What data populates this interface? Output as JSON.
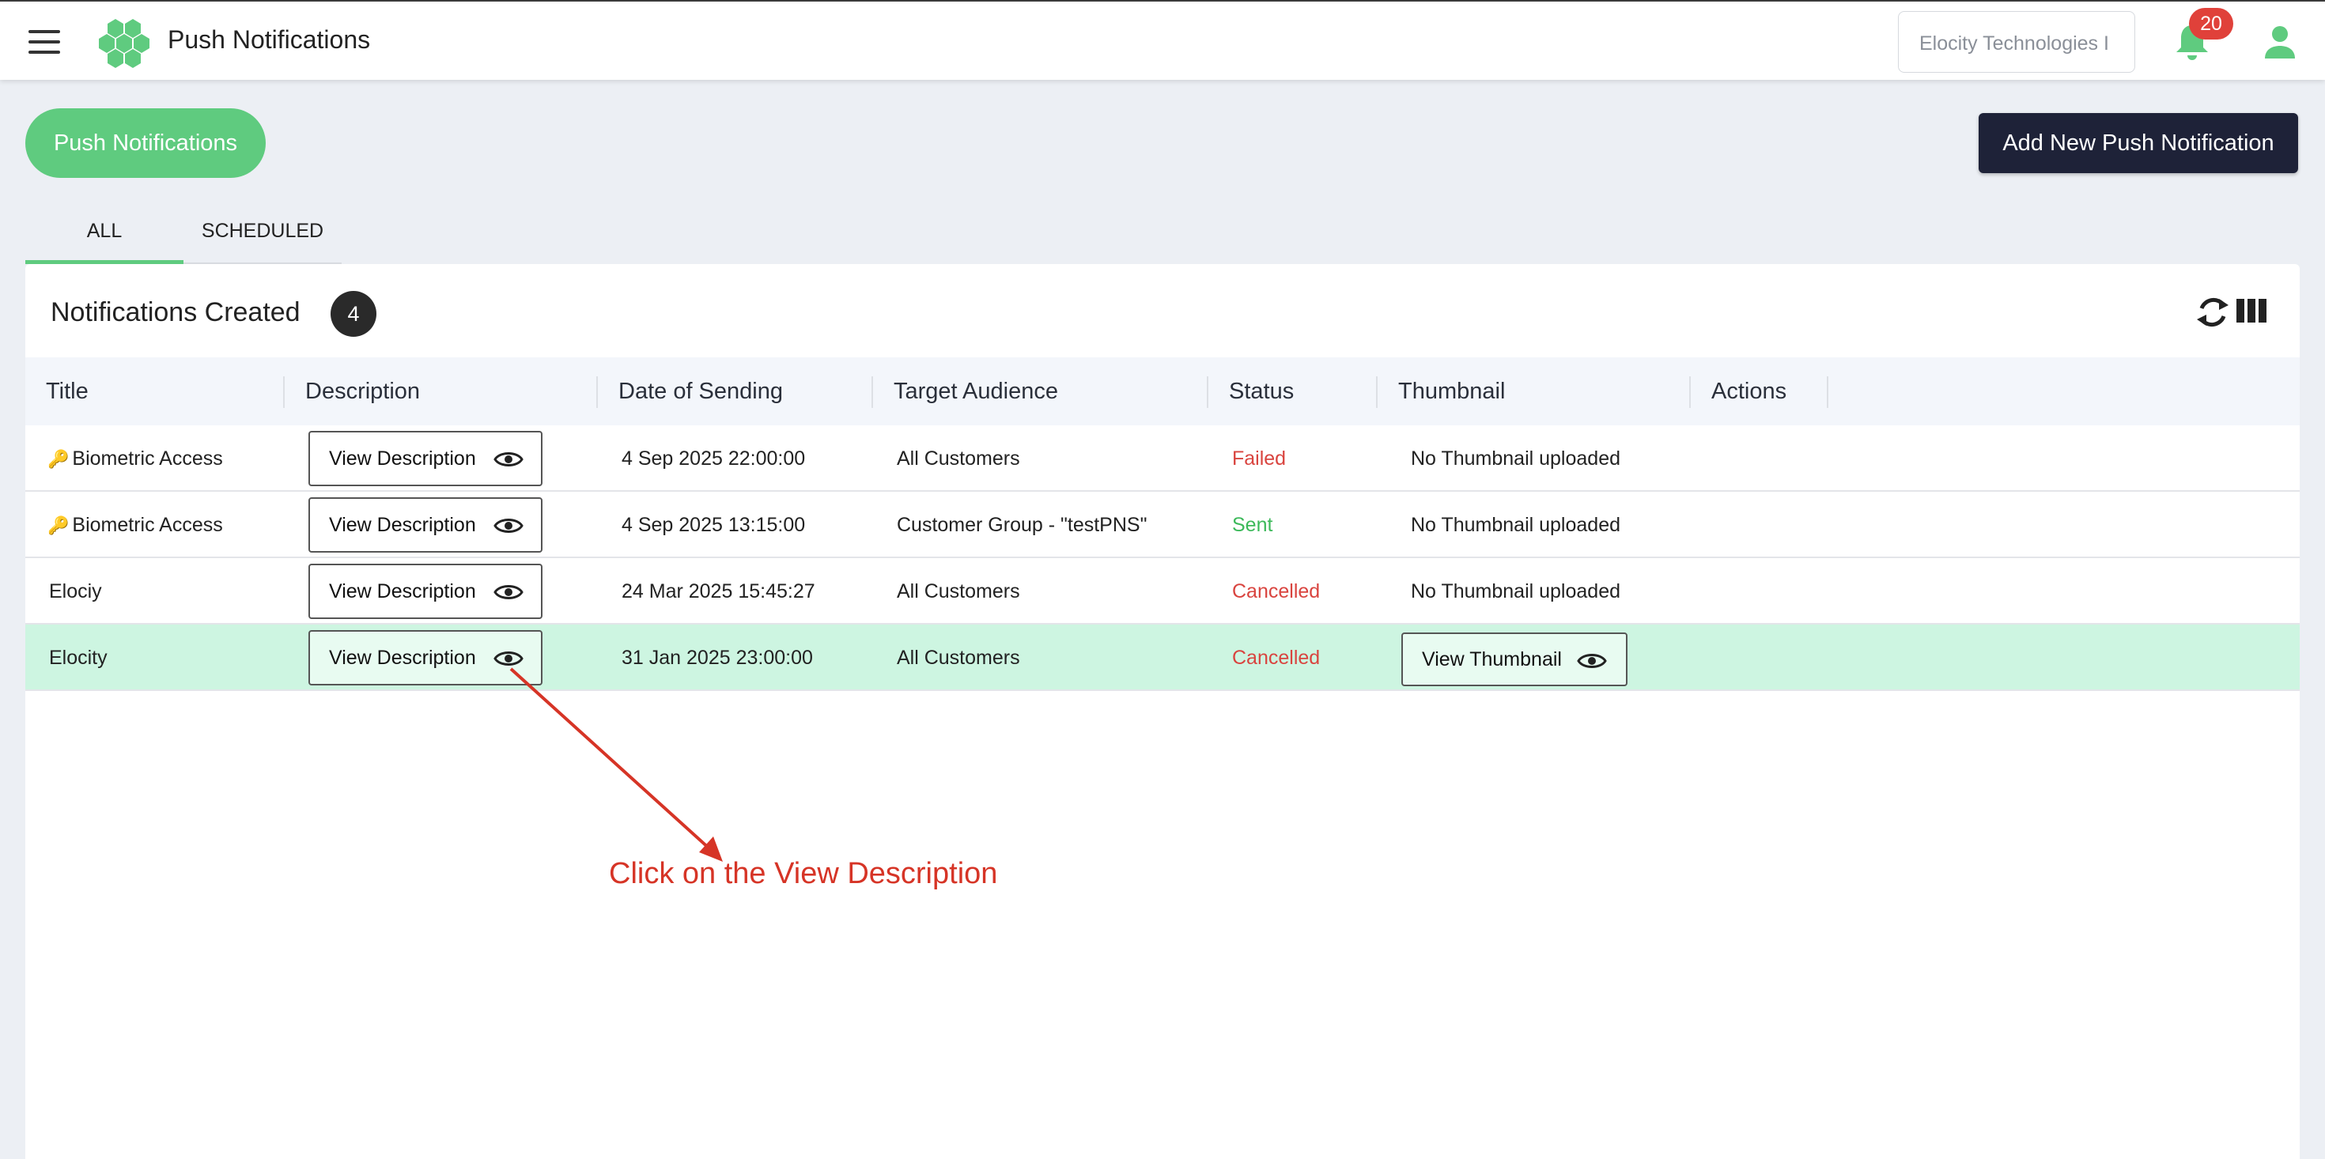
{
  "header": {
    "app_title": "Push Notifications",
    "org_selector_value": "Elocity Technologies I",
    "notification_count": "20",
    "accent_color": "#5fcb7f"
  },
  "toolbar": {
    "section_pill_label": "Push Notifications",
    "add_button_label": "Add New Push Notification"
  },
  "tabs": [
    {
      "label": "ALL",
      "active": true
    },
    {
      "label": "SCHEDULED",
      "active": false
    }
  ],
  "card": {
    "title": "Notifications Created",
    "count": "4"
  },
  "table": {
    "columns": [
      "Title",
      "Description",
      "Date of Sending",
      "Target Audience",
      "Status",
      "Thumbnail",
      "Actions"
    ],
    "rows": [
      {
        "title": "Biometric Access",
        "title_icon": "key-icon",
        "description_button": "View Description",
        "date": "4 Sep 2025 22:00:00",
        "audience": "All Customers",
        "status": "Failed",
        "thumbnail": "No Thumbnail uploaded"
      },
      {
        "title": "Biometric Access",
        "title_icon": "key-icon",
        "description_button": "View Description",
        "date": "4 Sep 2025 13:15:00",
        "audience": "Customer Group - \"testPNS\"",
        "status": "Sent",
        "thumbnail": "No Thumbnail uploaded"
      },
      {
        "title": "Elociy",
        "title_icon": "",
        "description_button": "View Description",
        "date": "24 Mar 2025 15:45:27",
        "audience": "All Customers",
        "status": "Cancelled",
        "thumbnail": "No Thumbnail uploaded"
      },
      {
        "title": "Elocity",
        "title_icon": "",
        "description_button": "View Description",
        "date": "31 Jan 2025 23:00:00",
        "audience": "All Customers",
        "status": "Cancelled",
        "thumbnail_button": "View Thumbnail"
      }
    ]
  },
  "annotation": {
    "text": "Click on the View Description",
    "color": "#d63426"
  }
}
